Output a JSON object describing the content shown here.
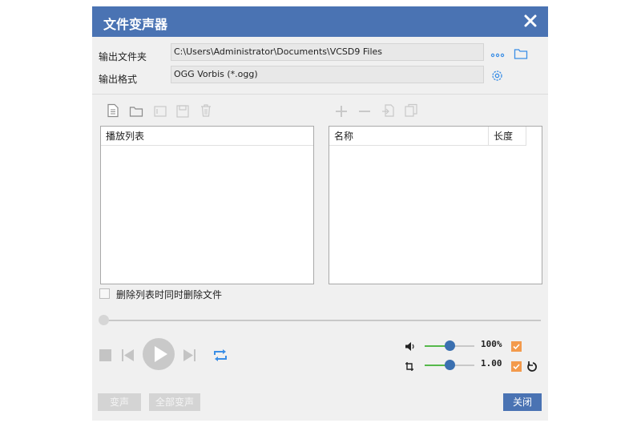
{
  "window": {
    "title": "文件变声器"
  },
  "output": {
    "folder_label": "输出文件夹",
    "folder_value": "C:\\Users\\Administrator\\Documents\\VCSD9 Files",
    "format_label": "输出格式",
    "format_value": "OGG Vorbis (*.ogg)"
  },
  "playlist": {
    "header": "播放列表"
  },
  "files": {
    "col_name": "名称",
    "col_length": "长度"
  },
  "options": {
    "delete_files_label": "删除列表时同时删除文件",
    "delete_files_checked": false
  },
  "player": {
    "progress": 0,
    "volume_percent": 100,
    "volume_label": "100%",
    "volume_checked": true,
    "tempo_value": 1.0,
    "tempo_label": "1.00",
    "tempo_checked": true
  },
  "buttons": {
    "convert": "变声",
    "convert_all": "全部变声",
    "close": "关闭"
  },
  "colors": {
    "titlebar": "#4a73b3",
    "accent_blue": "#3a8ee6",
    "slider_green": "#55b84a",
    "check_orange": "#f39a4c"
  }
}
